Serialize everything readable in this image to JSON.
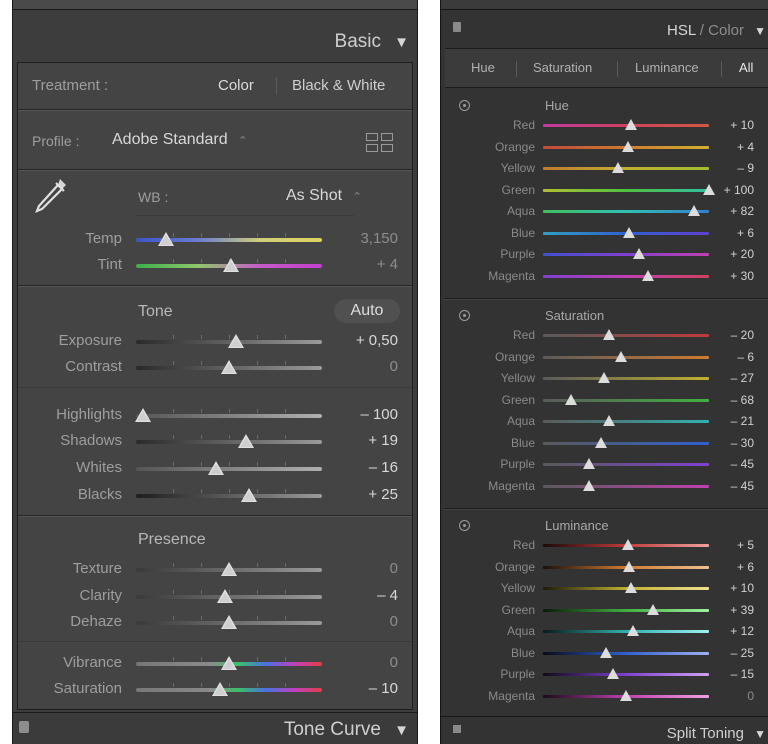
{
  "basic": {
    "title": "Basic",
    "collapse_icon": "triangle-down-icon",
    "treatment": {
      "label": "Treatment :",
      "color": "Color",
      "bw": "Black & White"
    },
    "profile": {
      "label": "Profile :",
      "value": "Adobe Standard",
      "chevron": "⌃",
      "browse_icon": "grid-icon"
    },
    "wb": {
      "label": "WB :",
      "value": "As Shot",
      "chevron": "⌃",
      "eyedropper_icon": "eyedropper-icon"
    },
    "temp": {
      "label": "Temp",
      "value": "3,150",
      "level": 0.16
    },
    "tint": {
      "label": "Tint",
      "value": "+ 4",
      "level": 0.51
    },
    "tone": {
      "title": "Tone",
      "auto": "Auto"
    },
    "exposure": {
      "label": "Exposure",
      "value": "+ 0,50",
      "level": 0.54
    },
    "contrast": {
      "label": "Contrast",
      "value": "0",
      "level": 0.5
    },
    "highlights": {
      "label": "Highlights",
      "value": "– 100",
      "level": 0.04
    },
    "shadows": {
      "label": "Shadows",
      "value": "+ 19",
      "level": 0.59
    },
    "whites": {
      "label": "Whites",
      "value": "– 16",
      "level": 0.43
    },
    "blacks": {
      "label": "Blacks",
      "value": "+ 25",
      "level": 0.61
    },
    "presence": {
      "title": "Presence"
    },
    "texture": {
      "label": "Texture",
      "value": "0",
      "level": 0.5
    },
    "clarity": {
      "label": "Clarity",
      "value": "– 4",
      "level": 0.48
    },
    "dehaze": {
      "label": "Dehaze",
      "value": "0",
      "level": 0.5
    },
    "vibrance": {
      "label": "Vibrance",
      "value": "0",
      "level": 0.5
    },
    "saturation": {
      "label": "Saturation",
      "value": "– 10",
      "level": 0.45
    }
  },
  "tone_curve": {
    "title": "Tone Curve"
  },
  "hsl": {
    "title_a": "HSL",
    "title_sep": " / ",
    "title_b": "Color",
    "tabs": [
      "Hue",
      "Saturation",
      "Luminance",
      "All"
    ],
    "hue": {
      "title": "Hue",
      "rows": [
        {
          "label": "Red",
          "value": "+ 10",
          "level": 0.53
        },
        {
          "label": "Orange",
          "value": "+ 4",
          "level": 0.51
        },
        {
          "label": "Yellow",
          "value": "– 9",
          "level": 0.45
        },
        {
          "label": "Green",
          "value": "+ 100",
          "level": 1.0
        },
        {
          "label": "Aqua",
          "value": "+ 82",
          "level": 0.91
        },
        {
          "label": "Blue",
          "value": "+ 6",
          "level": 0.52
        },
        {
          "label": "Purple",
          "value": "+ 20",
          "level": 0.58
        },
        {
          "label": "Magenta",
          "value": "+ 30",
          "level": 0.63
        }
      ]
    },
    "saturation": {
      "title": "Saturation",
      "rows": [
        {
          "label": "Red",
          "value": "– 20",
          "level": 0.4
        },
        {
          "label": "Orange",
          "value": "– 6",
          "level": 0.47
        },
        {
          "label": "Yellow",
          "value": "– 27",
          "level": 0.37
        },
        {
          "label": "Green",
          "value": "– 68",
          "level": 0.17
        },
        {
          "label": "Aqua",
          "value": "– 21",
          "level": 0.4
        },
        {
          "label": "Blue",
          "value": "– 30",
          "level": 0.35
        },
        {
          "label": "Purple",
          "value": "– 45",
          "level": 0.28
        },
        {
          "label": "Magenta",
          "value": "– 45",
          "level": 0.28
        }
      ]
    },
    "luminance": {
      "title": "Luminance",
      "rows": [
        {
          "label": "Red",
          "value": "+ 5",
          "level": 0.51
        },
        {
          "label": "Orange",
          "value": "+ 6",
          "level": 0.52
        },
        {
          "label": "Yellow",
          "value": "+ 10",
          "level": 0.53
        },
        {
          "label": "Green",
          "value": "+ 39",
          "level": 0.66
        },
        {
          "label": "Aqua",
          "value": "+ 12",
          "level": 0.54
        },
        {
          "label": "Blue",
          "value": "– 25",
          "level": 0.38
        },
        {
          "label": "Purple",
          "value": "– 15",
          "level": 0.42
        },
        {
          "label": "Magenta",
          "value": "0",
          "level": 0.5
        }
      ]
    }
  },
  "split_toning": {
    "title": "Split Toning"
  },
  "colors": {
    "panel_bg": "#444444",
    "hsl_bg": "#333333",
    "thumb": "#dcdcdc"
  }
}
